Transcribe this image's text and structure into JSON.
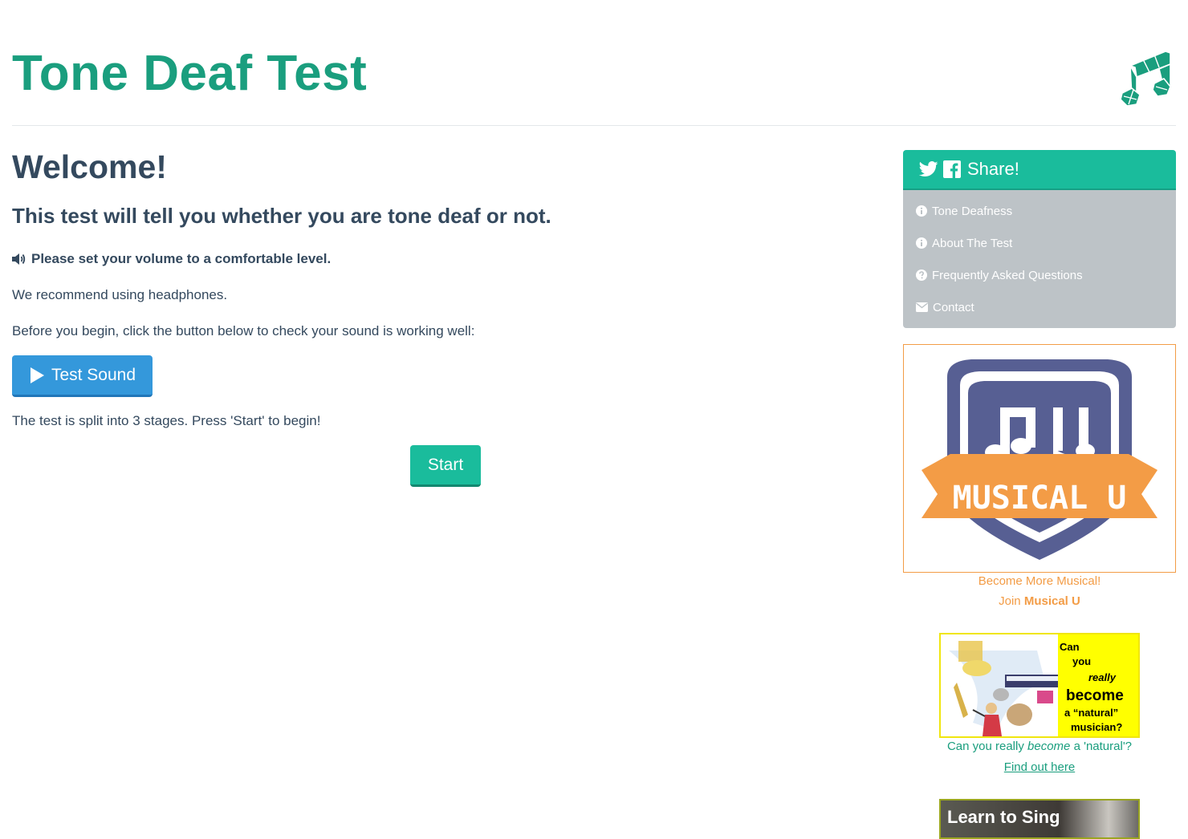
{
  "header": {
    "title": "Tone Deaf Test"
  },
  "main": {
    "welcome": "Welcome!",
    "subtitle": "This test will tell you whether you are tone deaf or not.",
    "volume_note": "Please set your volume to a comfortable level.",
    "headphones_note": "We recommend using headphones.",
    "sound_check_note": "Before you begin, click the button below to check your sound is working well:",
    "test_sound_label": "Test Sound",
    "stages_note": "The test is split into 3 stages. Press 'Start' to begin!",
    "start_label": "Start"
  },
  "sidebar": {
    "share_label": "Share!",
    "nav": [
      {
        "label": "Tone Deafness",
        "icon": "info-circle-icon"
      },
      {
        "label": "About The Test",
        "icon": "info-circle-icon"
      },
      {
        "label": "Frequently Asked Questions",
        "icon": "question-circle-icon"
      },
      {
        "label": "Contact",
        "icon": "envelope-icon"
      }
    ],
    "musical_u": {
      "logo_text": "MUSICAL U",
      "logo_letters": "MU",
      "caption_line1": "Become More Musical!",
      "caption_join": "Join",
      "caption_brand": "Musical U"
    },
    "natural_ad": {
      "text_lines": [
        "Can",
        "you",
        "really",
        "become",
        "a “natural”",
        "musician?"
      ],
      "caption_before": "Can you really",
      "caption_em": "become",
      "caption_after": "a 'natural'?",
      "link": "Find out here"
    },
    "sing_ad": {
      "text": "Learn to Sing"
    }
  },
  "colors": {
    "title_green": "#1a9e7e",
    "turquoise": "#1abc9c",
    "blue": "#3498db",
    "text": "#34495e",
    "gray_nav": "#bdc3c7",
    "orange": "#f39c46"
  }
}
